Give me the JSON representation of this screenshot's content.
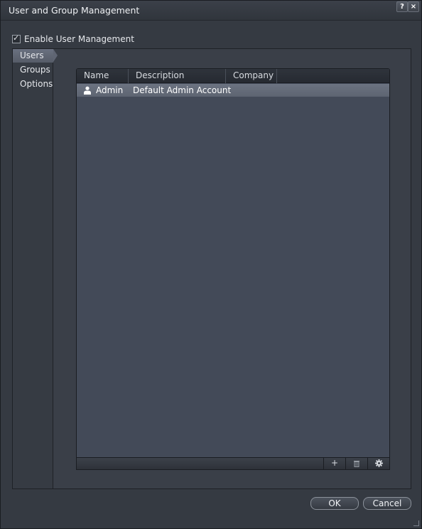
{
  "window": {
    "title": "User and Group Management",
    "help_label": "?",
    "close_label": "×"
  },
  "enable_user_management": {
    "label": "Enable User Management",
    "checked": true,
    "check_glyph": "✓"
  },
  "nav": {
    "items": [
      {
        "label": "Users",
        "active": true
      },
      {
        "label": "Groups",
        "active": false
      },
      {
        "label": "Options",
        "active": false
      }
    ]
  },
  "users_table": {
    "columns": [
      "Name",
      "Description",
      "Company"
    ],
    "rows": [
      {
        "icon": "user-icon",
        "name": "Admin",
        "description": "Default Admin Account",
        "company": ""
      }
    ]
  },
  "table_toolbar": {
    "add_label": "+",
    "delete_icon": "trash-icon",
    "settings_icon": "gear-icon"
  },
  "dialog_buttons": {
    "ok_label": "OK",
    "cancel_label": "Cancel"
  },
  "colors": {
    "window_bg": "#353a42",
    "selected_row": "#656c7a",
    "table_bg": "#434a58"
  }
}
